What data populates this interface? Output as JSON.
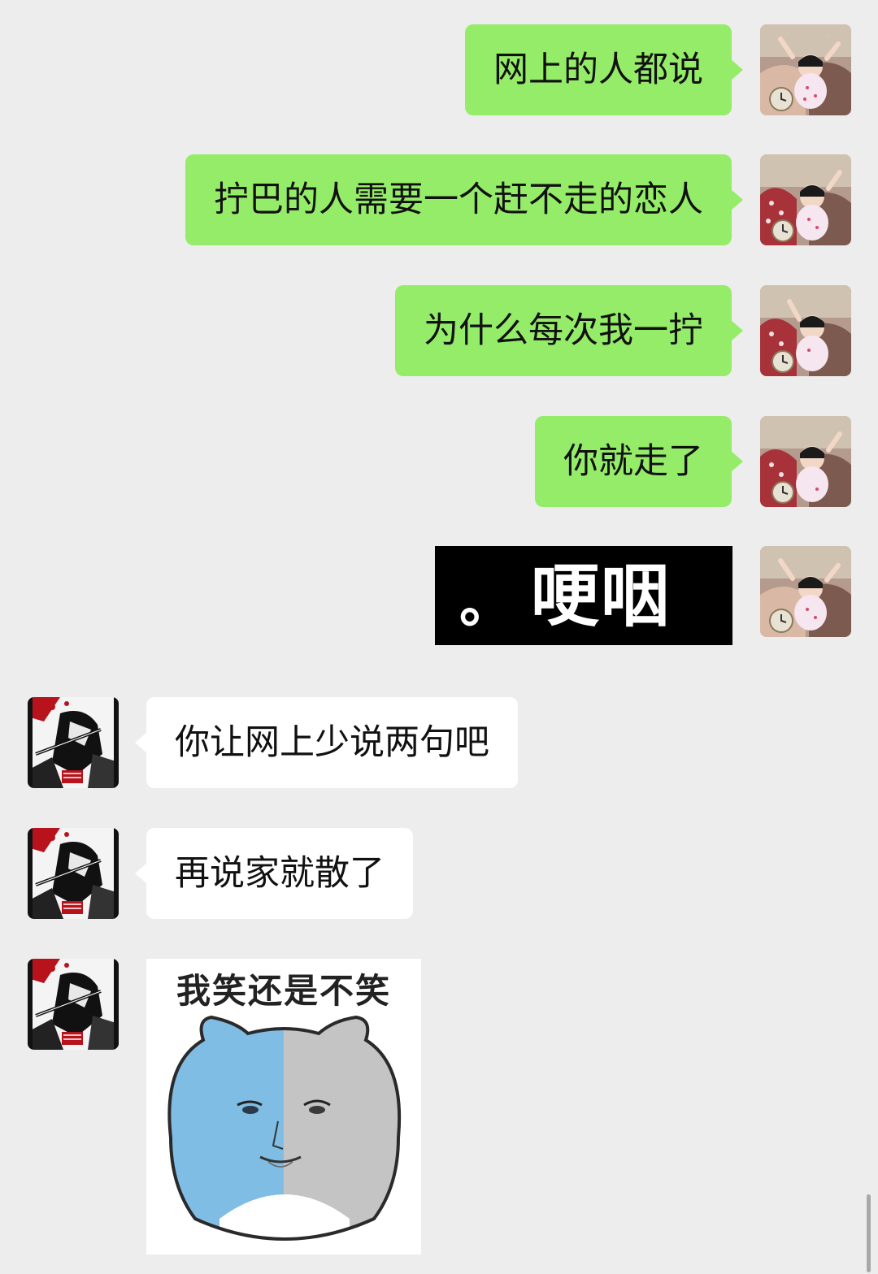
{
  "messages": [
    {
      "from": "me",
      "type": "text",
      "text": "网上的人都说"
    },
    {
      "from": "me",
      "type": "text",
      "text": "拧巴的人需要一个赶不走的恋人"
    },
    {
      "from": "me",
      "type": "text",
      "text": "为什么每次我一拧"
    },
    {
      "from": "me",
      "type": "text",
      "text": "你就走了"
    },
    {
      "from": "me",
      "type": "sticker",
      "text": "哽咽",
      "prefix": "。"
    },
    {
      "from": "them",
      "type": "text",
      "text": "你让网上少说两句吧"
    },
    {
      "from": "them",
      "type": "text",
      "text": "再说家就散了"
    },
    {
      "from": "them",
      "type": "sticker",
      "text": "我笑还是不笑"
    }
  ],
  "colors": {
    "background": "#ededed",
    "my_bubble": "#95ec69",
    "their_bubble": "#ffffff",
    "sticker_bg": "#000000",
    "cat_blue": "#7fbde4",
    "cat_gray": "#c4c4c4"
  },
  "icons": {
    "my_avatar": "cartoon-kid-avatar-icon",
    "their_avatar": "manga-warrior-avatar-icon"
  }
}
